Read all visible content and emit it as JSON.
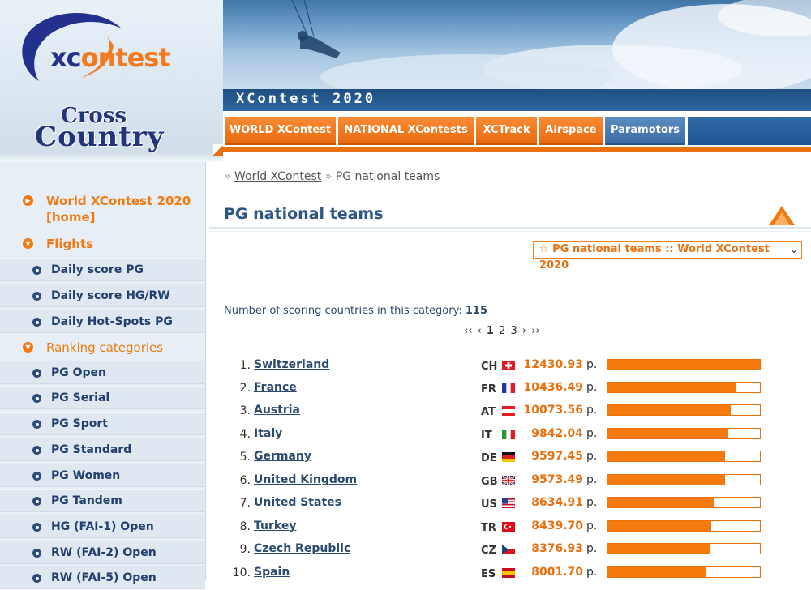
{
  "header": {
    "logo_xc": "xc",
    "logo_rest": "ontest",
    "cc_logo_line1": "Cross",
    "cc_logo_line2": "Country",
    "site_title": "XContest 2020"
  },
  "nav": {
    "tabs": [
      {
        "label": "WORLD XContest"
      },
      {
        "label": "NATIONAL XContests"
      },
      {
        "label": "XCTrack"
      },
      {
        "label": "Airspace"
      },
      {
        "label": "Paramotors"
      }
    ]
  },
  "sidebar": {
    "home_label": "World XContest 2020 [home]",
    "flights_label": "Flights",
    "flight_items": [
      {
        "label": "Daily score PG"
      },
      {
        "label": "Daily score HG/RW"
      },
      {
        "label": "Daily Hot-Spots PG"
      }
    ],
    "ranking_label": "Ranking categories",
    "ranking_items": [
      {
        "label": "PG Open"
      },
      {
        "label": "PG Serial"
      },
      {
        "label": "PG Sport"
      },
      {
        "label": "PG Standard"
      },
      {
        "label": "PG Women"
      },
      {
        "label": "PG Tandem"
      },
      {
        "label": "HG (FAI-1) Open"
      },
      {
        "label": "RW (FAI-2) Open"
      },
      {
        "label": "RW (FAI-5) Open"
      }
    ]
  },
  "breadcrumb": {
    "link": "World XContest",
    "current": "PG national teams"
  },
  "page_title": "PG national teams",
  "category_select": {
    "selected": "☆ PG national teams :: World XContest 2020"
  },
  "count": {
    "label": "Number of scoring countries in this category:",
    "value": "115"
  },
  "pager": {
    "first": "‹‹",
    "prev": "‹",
    "pages": [
      "1",
      "2",
      "3"
    ],
    "next": "›",
    "last": "››"
  },
  "ranking": {
    "unit": "p.",
    "max_score": 12430.93,
    "rows": [
      {
        "rank": "1.",
        "country": "Switzerland",
        "code": "CH",
        "flag": "ch",
        "score": "12430.93"
      },
      {
        "rank": "2.",
        "country": "France",
        "code": "FR",
        "flag": "fr",
        "score": "10436.49"
      },
      {
        "rank": "3.",
        "country": "Austria",
        "code": "AT",
        "flag": "at",
        "score": "10073.56"
      },
      {
        "rank": "4.",
        "country": "Italy",
        "code": "IT",
        "flag": "it",
        "score": "9842.04"
      },
      {
        "rank": "5.",
        "country": "Germany",
        "code": "DE",
        "flag": "de",
        "score": "9597.45"
      },
      {
        "rank": "6.",
        "country": "United Kingdom",
        "code": "GB",
        "flag": "gb",
        "score": "9573.49"
      },
      {
        "rank": "7.",
        "country": "United States",
        "code": "US",
        "flag": "us",
        "score": "8634.91"
      },
      {
        "rank": "8.",
        "country": "Turkey",
        "code": "TR",
        "flag": "tr",
        "score": "8439.70"
      },
      {
        "rank": "9.",
        "country": "Czech Republic",
        "code": "CZ",
        "flag": "cz",
        "score": "8376.93"
      },
      {
        "rank": "10.",
        "country": "Spain",
        "code": "ES",
        "flag": "es",
        "score": "8001.70"
      }
    ]
  },
  "colors": {
    "accent_orange": "#f47a0e",
    "nav_blue": "#3a6da4",
    "title_blue": "#2b5585"
  }
}
